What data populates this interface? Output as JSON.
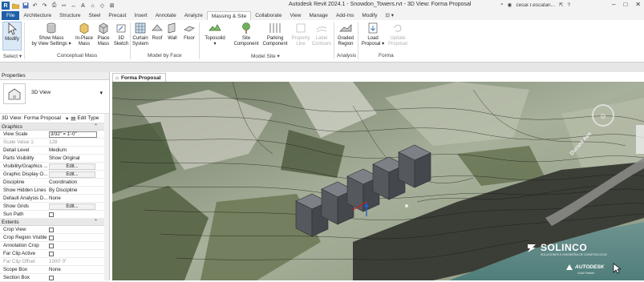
{
  "titlebar": {
    "app_logo": "R",
    "title": "Autodesk Revit 2024.1 - Snowdon_Towers.rvt - 3D View: Forma Proposal",
    "user": "cesar.r.escalan...",
    "qat_icons": [
      "open-icon",
      "save-icon",
      "undo-icon",
      "redo-icon",
      "print-icon",
      "measure-icon",
      "dimension-icon",
      "text-icon",
      "3d-view-icon",
      "section-icon",
      "close-hidden-icon"
    ],
    "window_controls": [
      "minimize-icon",
      "maximize-icon",
      "close-icon"
    ]
  },
  "tabs": [
    "File",
    "Architecture",
    "Structure",
    "Steel",
    "Precast",
    "Insert",
    "Annotate",
    "Analyze",
    "Massing & Site",
    "Collaborate",
    "View",
    "Manage",
    "Add-Ins",
    "Modify",
    "⊡ ▾"
  ],
  "active_tab": "Massing & Site",
  "ribbon": {
    "modify": "Modify",
    "select": "Select ▾",
    "show_mass": "Show Mass\nby View Settings ▾",
    "in_place_mass": "In-Place\nMass",
    "place_mass": "Place\nMass",
    "sketch_3d": "3D\nSketch",
    "curtain_system": "Curtain\nSystem",
    "roof": "Roof",
    "wall": "Wall",
    "floor": "Floor",
    "toposolid": "Toposolid\n▾",
    "site_component": "Site\nComponent",
    "parking_component": "Parking\nComponent",
    "property_line": "Property\nLine",
    "label_contours": "Label\nContours",
    "graded_region": "Graded\nRegion",
    "load_proposal": "Load\nProposal ▾",
    "update_proposal": "Update\nProposal",
    "panels": {
      "select": "Select ▾",
      "conceptual_mass": "Conceptual Mass",
      "model_by_face": "Model by Face",
      "model_site": "Model Site ▾",
      "analysis": "Analysis",
      "forma": "Forma"
    }
  },
  "properties": {
    "title": "Properties",
    "type_name": "3D View",
    "selector": "3D View: Forma Proposal",
    "edit_type": "Edit Type",
    "groups": {
      "graphics": "Graphics",
      "extents": "Extents"
    },
    "graphics_rows": [
      {
        "key": "View Scale",
        "value": "3/32\" = 1'-0\"",
        "kind": "box"
      },
      {
        "key": "Scale Value    1:",
        "value": "128",
        "kind": "dim"
      },
      {
        "key": "Detail Level",
        "value": "Medium",
        "kind": "text"
      },
      {
        "key": "Parts Visibility",
        "value": "Show Original",
        "kind": "text"
      },
      {
        "key": "Visibility/Graphics ...",
        "value": "Edit...",
        "kind": "edit"
      },
      {
        "key": "Graphic Display O...",
        "value": "Edit...",
        "kind": "edit"
      },
      {
        "key": "Discipline",
        "value": "Coordination",
        "kind": "text"
      },
      {
        "key": "Show Hidden Lines",
        "value": "By Discipline",
        "kind": "text"
      },
      {
        "key": "Default Analysis D...",
        "value": "None",
        "kind": "text"
      },
      {
        "key": "Show Grids",
        "value": "Edit...",
        "kind": "edit"
      },
      {
        "key": "Sun Path",
        "value": "",
        "kind": "check"
      }
    ],
    "extents_rows": [
      {
        "key": "Crop View",
        "value": "",
        "kind": "check"
      },
      {
        "key": "Crop Region Visible",
        "value": "",
        "kind": "check"
      },
      {
        "key": "Annotation Crop",
        "value": "",
        "kind": "check"
      },
      {
        "key": "Far Clip Active",
        "value": "",
        "kind": "check"
      },
      {
        "key": "Far Clip Offset",
        "value": "1000' 0\"",
        "kind": "dim"
      },
      {
        "key": "Scope Box",
        "value": "None",
        "kind": "text"
      },
      {
        "key": "Section Box",
        "value": "",
        "kind": "check"
      }
    ]
  },
  "view": {
    "tab_label": "Forma Proposal",
    "street_label": "Durant Ave",
    "nav_cube": "nav-wheel-icon"
  },
  "watermark": {
    "brand": "SOLINCO",
    "tagline": "SOLUCIONES E INGENIERIA DE CONSTRUCCION",
    "partner": "AUTODESK",
    "partner_tag": "Gold Partner"
  },
  "colors": {
    "file_tab": "#1f5fa8",
    "terrain_dark": "#3e4d36",
    "terrain_light": "#9aa58a",
    "building": "#55585d",
    "water": "#5d8a86"
  }
}
